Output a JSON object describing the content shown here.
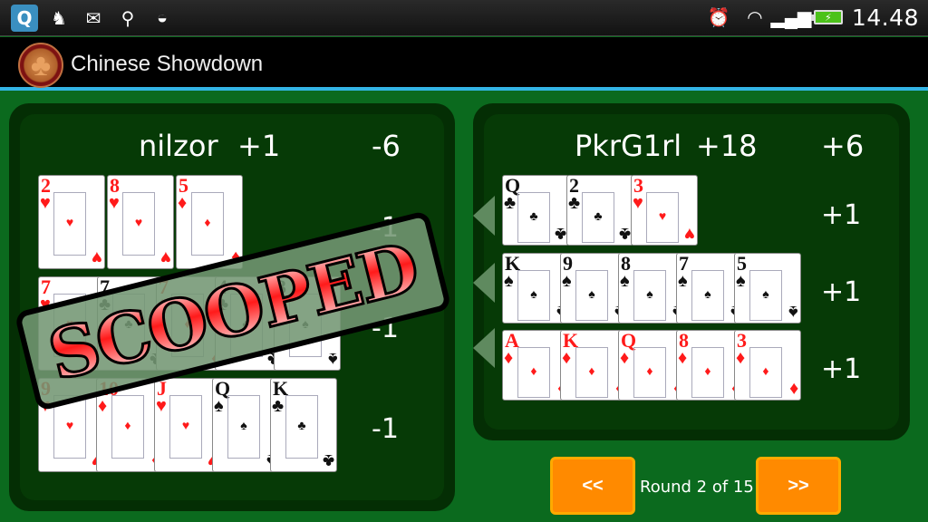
{
  "status_bar": {
    "left_icons": [
      "q-app-icon",
      "mascot-icon",
      "gmail-icon",
      "usb-icon",
      "android-icon"
    ],
    "right_icons": [
      "alarm-icon",
      "wifi-icon",
      "signal-icon",
      "battery-charging-icon"
    ],
    "time": "14.48"
  },
  "app": {
    "title": "Chinese Showdown",
    "logo": "clover-logo-icon"
  },
  "players": [
    {
      "name": "nilzor",
      "hand_score": "+1",
      "total_score": "-6",
      "status": "SCOOPED",
      "rows": [
        {
          "score": "-1",
          "cards": [
            {
              "rank": "2",
              "suit": "♥",
              "color": "red"
            },
            {
              "rank": "8",
              "suit": "♥",
              "color": "red"
            },
            {
              "rank": "5",
              "suit": "♦",
              "color": "red"
            }
          ]
        },
        {
          "score": "-1",
          "cards": [
            {
              "rank": "7",
              "suit": "♥",
              "color": "red"
            },
            {
              "rank": "7",
              "suit": "♣",
              "color": "black"
            },
            {
              "rank": "7",
              "suit": "♦",
              "color": "red"
            },
            {
              "rank": "4",
              "suit": "♣",
              "color": "black"
            },
            {
              "rank": "3",
              "suit": "♠",
              "color": "black"
            }
          ]
        },
        {
          "score": "-1",
          "cards": [
            {
              "rank": "9",
              "suit": "♥",
              "color": "red"
            },
            {
              "rank": "10",
              "suit": "♦",
              "color": "red"
            },
            {
              "rank": "J",
              "suit": "♥",
              "color": "red"
            },
            {
              "rank": "Q",
              "suit": "♠",
              "color": "black"
            },
            {
              "rank": "K",
              "suit": "♣",
              "color": "black"
            }
          ]
        }
      ]
    },
    {
      "name": "PkrG1rl",
      "hand_score": "+18",
      "total_score": "+6",
      "rows": [
        {
          "score": "+1",
          "cards": [
            {
              "rank": "Q",
              "suit": "♣",
              "color": "black"
            },
            {
              "rank": "2",
              "suit": "♣",
              "color": "black"
            },
            {
              "rank": "3",
              "suit": "♥",
              "color": "red"
            }
          ]
        },
        {
          "score": "+1",
          "cards": [
            {
              "rank": "K",
              "suit": "♠",
              "color": "black"
            },
            {
              "rank": "9",
              "suit": "♠",
              "color": "black"
            },
            {
              "rank": "8",
              "suit": "♠",
              "color": "black"
            },
            {
              "rank": "7",
              "suit": "♠",
              "color": "black"
            },
            {
              "rank": "5",
              "suit": "♠",
              "color": "black"
            }
          ]
        },
        {
          "score": "+1",
          "cards": [
            {
              "rank": "A",
              "suit": "♦",
              "color": "red"
            },
            {
              "rank": "K",
              "suit": "♦",
              "color": "red"
            },
            {
              "rank": "Q",
              "suit": "♦",
              "color": "red"
            },
            {
              "rank": "8",
              "suit": "♦",
              "color": "red"
            },
            {
              "rank": "3",
              "suit": "♦",
              "color": "red"
            }
          ]
        }
      ]
    }
  ],
  "navigation": {
    "prev_label": "<<",
    "next_label": ">>",
    "round_text": "Round 2 of 15"
  },
  "colors": {
    "felt": "#0b6a1e",
    "panel": "#063a06",
    "accent_bar": "#33b5e5",
    "button": "#ff8a00",
    "red_suit": "#ff1a1a"
  }
}
